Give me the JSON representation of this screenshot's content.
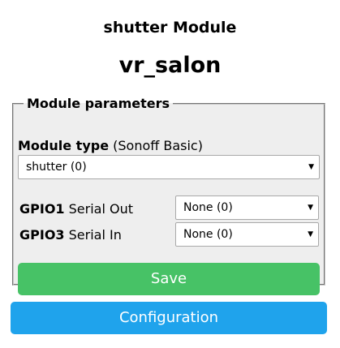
{
  "header": {
    "module_title": "shutter Module",
    "device_name": "vr_salon"
  },
  "module_parameters": {
    "legend": "Module parameters",
    "module_type_label": "Module type",
    "module_type_hint": "(Sonoff Basic)",
    "module_type_value": "shutter (0)",
    "gpios": [
      {
        "pin": "GPIO1",
        "function": "Serial Out",
        "value": "None (0)"
      },
      {
        "pin": "GPIO3",
        "function": "Serial In",
        "value": "None (0)"
      }
    ],
    "save_label": "Save"
  },
  "nav": {
    "configuration_label": "Configuration"
  },
  "colors": {
    "save_button": "#47c266",
    "config_button": "#1fa3ec",
    "fieldset_bg": "#eeeeee"
  },
  "icons": {
    "dropdown": "triangle-down"
  }
}
